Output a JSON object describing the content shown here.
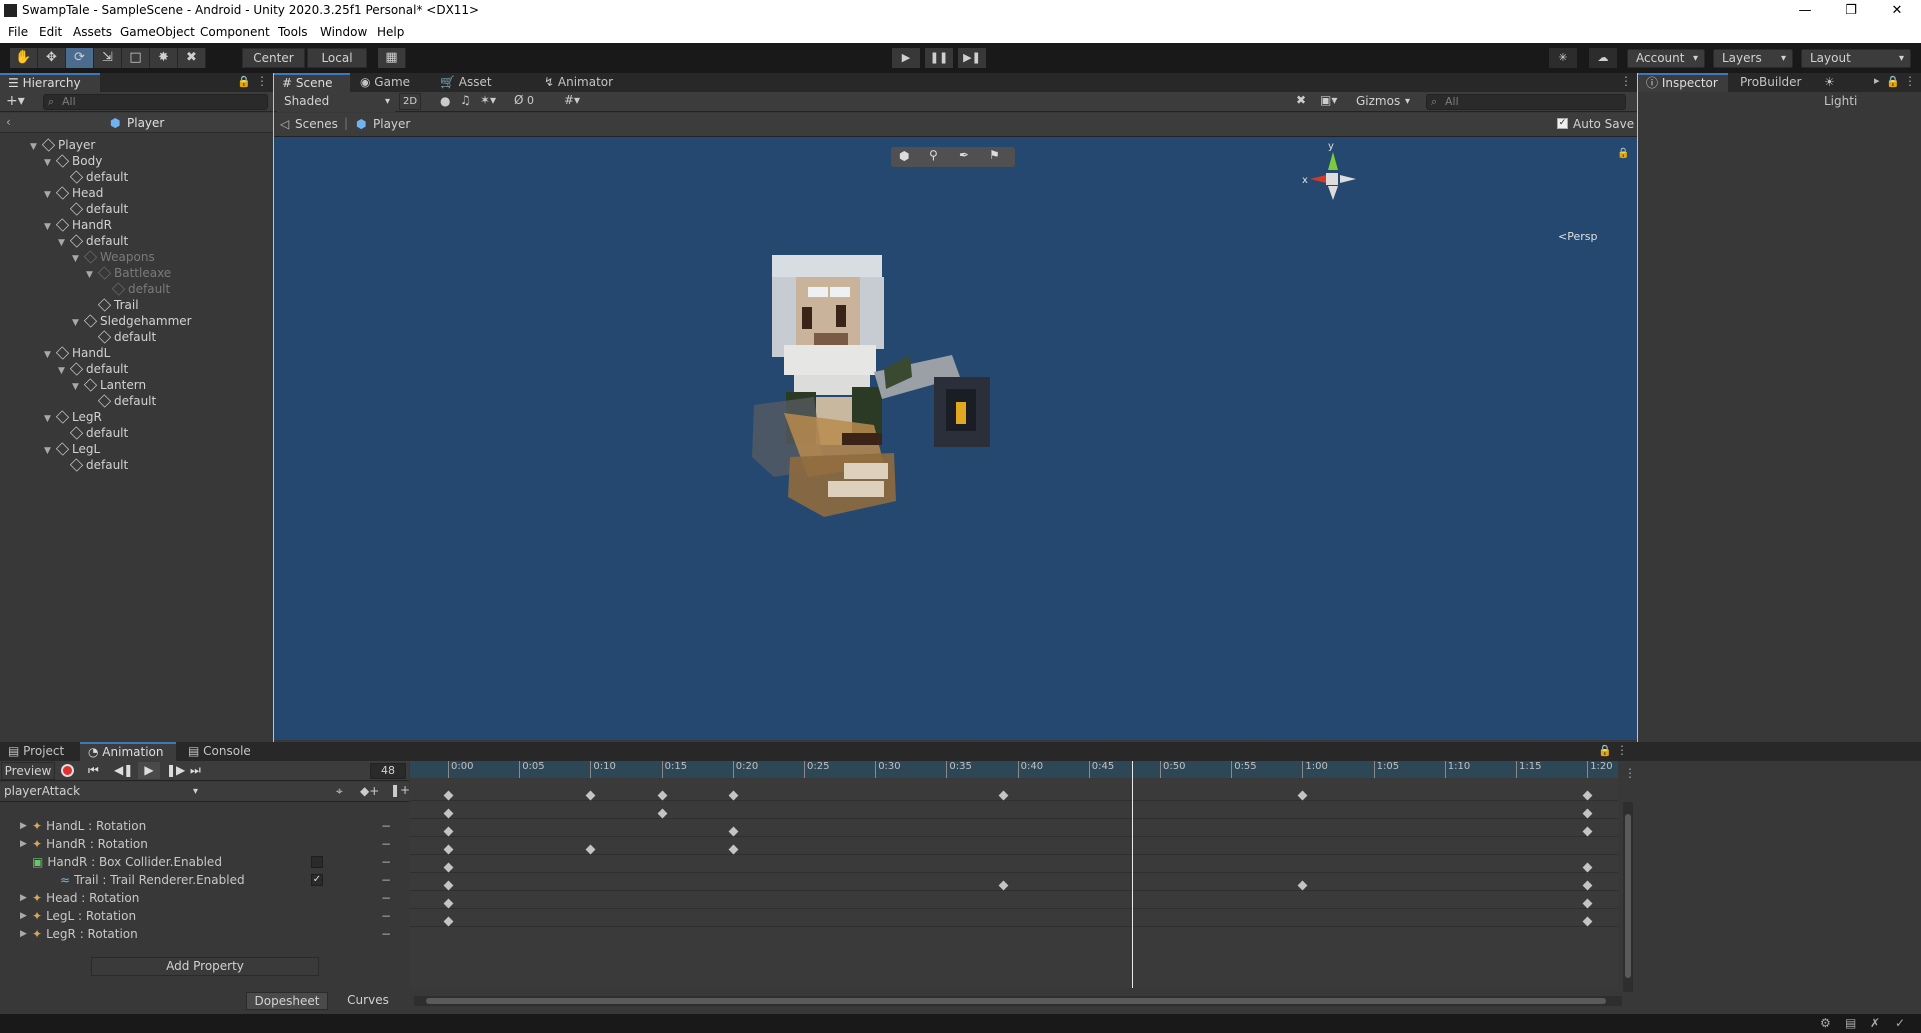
{
  "window": {
    "title": "SwampTale - SampleScene - Android - Unity 2020.3.25f1 Personal* <DX11>",
    "minimize": "—",
    "maximize": "❐",
    "close": "✕"
  },
  "menu": [
    "File",
    "Edit",
    "Assets",
    "GameObject",
    "Component",
    "Tools",
    "Window",
    "Help"
  ],
  "toolbar": {
    "pivot": "Center",
    "space": "Local",
    "account": "Account",
    "layers": "Layers",
    "layout": "Layout"
  },
  "hierarchy": {
    "tab": "Hierarchy",
    "search_placeholder": "All",
    "breadcrumb": "Player",
    "nodes": [
      {
        "label": "Player",
        "depth": 0,
        "expand": true,
        "dim": false
      },
      {
        "label": "Body",
        "depth": 1,
        "expand": true,
        "dim": false
      },
      {
        "label": "default",
        "depth": 2,
        "expand": false,
        "dim": false
      },
      {
        "label": "Head",
        "depth": 1,
        "expand": true,
        "dim": false
      },
      {
        "label": "default",
        "depth": 2,
        "expand": false,
        "dim": false
      },
      {
        "label": "HandR",
        "depth": 1,
        "expand": true,
        "dim": false
      },
      {
        "label": "default",
        "depth": 2,
        "expand": true,
        "dim": false
      },
      {
        "label": "Weapons",
        "depth": 3,
        "expand": true,
        "dim": true
      },
      {
        "label": "Battleaxe",
        "depth": 4,
        "expand": true,
        "dim": true
      },
      {
        "label": "default",
        "depth": 5,
        "expand": false,
        "dim": true
      },
      {
        "label": "Trail",
        "depth": 4,
        "expand": false,
        "dim": false
      },
      {
        "label": "Sledgehammer",
        "depth": 3,
        "expand": true,
        "dim": false
      },
      {
        "label": "default",
        "depth": 4,
        "expand": false,
        "dim": false
      },
      {
        "label": "HandL",
        "depth": 1,
        "expand": true,
        "dim": false
      },
      {
        "label": "default",
        "depth": 2,
        "expand": true,
        "dim": false
      },
      {
        "label": "Lantern",
        "depth": 3,
        "expand": true,
        "dim": false
      },
      {
        "label": "default",
        "depth": 4,
        "expand": false,
        "dim": false
      },
      {
        "label": "LegR",
        "depth": 1,
        "expand": true,
        "dim": false
      },
      {
        "label": "default",
        "depth": 2,
        "expand": false,
        "dim": false
      },
      {
        "label": "LegL",
        "depth": 1,
        "expand": true,
        "dim": false
      },
      {
        "label": "default",
        "depth": 2,
        "expand": false,
        "dim": false
      }
    ]
  },
  "scene": {
    "tabs": [
      "Scene",
      "Game",
      "Asset Store",
      "Animator"
    ],
    "shading": "Shaded",
    "mode_2d": "2D",
    "hidden_count": "0",
    "gizmos": "Gizmos",
    "search_placeholder": "All",
    "breadcrumb_root": "Scenes",
    "breadcrumb_prefab": "Player",
    "auto_save": "Auto Save",
    "gizmo_y": "y",
    "gizmo_x": "x",
    "persp": "<Persp"
  },
  "inspector": {
    "tabs": [
      "Inspector",
      "ProBuilder",
      "Lighti"
    ]
  },
  "animation": {
    "tabs": [
      "Project",
      "Animation",
      "Console"
    ],
    "preview": "Preview",
    "frame": "48",
    "clip": "playerAttack",
    "ruler": [
      "0:00",
      "0:05",
      "0:10",
      "0:15",
      "0:20",
      "0:25",
      "0:30",
      "0:35",
      "0:40",
      "0:45",
      "0:50",
      "0:55",
      "1:00",
      "1:05",
      "1:10",
      "1:15",
      "1:20"
    ],
    "properties": [
      {
        "label": "HandL : Rotation",
        "kind": "transform",
        "expand": true,
        "indent": 0
      },
      {
        "label": "HandR : Rotation",
        "kind": "transform",
        "expand": true,
        "indent": 0
      },
      {
        "label": "HandR : Box Collider.Enabled",
        "kind": "collider",
        "expand": false,
        "indent": 0,
        "checkbox": false
      },
      {
        "label": "Trail : Trail Renderer.Enabled",
        "kind": "trail",
        "expand": false,
        "indent": 1,
        "checkbox": true
      },
      {
        "label": "Head : Rotation",
        "kind": "transform",
        "expand": true,
        "indent": 0
      },
      {
        "label": "LegL : Rotation",
        "kind": "transform",
        "expand": true,
        "indent": 0
      },
      {
        "label": "LegR : Rotation",
        "kind": "transform",
        "expand": true,
        "indent": 0
      }
    ],
    "add_property": "Add Property",
    "bottom_tabs": [
      "Dopesheet",
      "Curves"
    ],
    "playhead_time": 0.48,
    "keyframes": {
      "summary": [
        0,
        0.1,
        0.15,
        0.2,
        0.39,
        1.0,
        1.2
      ],
      "rows": [
        [
          0,
          0.15,
          1.2
        ],
        [
          0,
          0.2,
          1.2
        ],
        [
          0,
          0.1,
          0.2
        ],
        [
          0,
          1.2
        ],
        [
          0,
          0.39,
          1.0,
          1.2
        ],
        [
          0,
          1.2
        ],
        [
          0,
          1.2
        ]
      ]
    }
  }
}
